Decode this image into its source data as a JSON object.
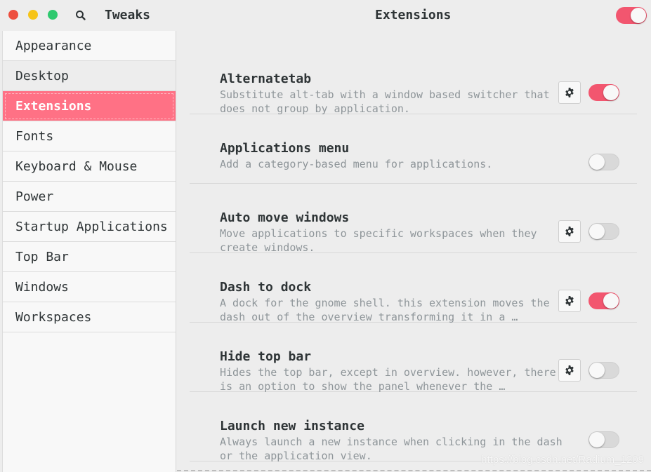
{
  "window": {
    "app_title": "Tweaks",
    "page_title": "Extensions",
    "global_extensions_enabled": true,
    "controls": [
      "close",
      "minimize",
      "maximize"
    ]
  },
  "sidebar": {
    "items": [
      {
        "label": "Appearance",
        "state": "normal"
      },
      {
        "label": "Desktop",
        "state": "hover"
      },
      {
        "label": "Extensions",
        "state": "active"
      },
      {
        "label": "Fonts",
        "state": "normal"
      },
      {
        "label": "Keyboard & Mouse",
        "state": "normal"
      },
      {
        "label": "Power",
        "state": "normal"
      },
      {
        "label": "Startup Applications",
        "state": "normal"
      },
      {
        "label": "Top Bar",
        "state": "normal"
      },
      {
        "label": "Windows",
        "state": "normal"
      },
      {
        "label": "Workspaces",
        "state": "normal"
      }
    ]
  },
  "extensions": [
    {
      "name": "Alternatetab",
      "description": "Substitute alt-tab with a window based switcher that does not group by application.",
      "has_settings": true,
      "enabled": true
    },
    {
      "name": "Applications menu",
      "description": "Add a category-based menu for applications.",
      "has_settings": false,
      "enabled": false
    },
    {
      "name": "Auto move windows",
      "description": "Move applications to specific workspaces when they create windows.",
      "has_settings": true,
      "enabled": false
    },
    {
      "name": "Dash to dock",
      "description": "A dock for the gnome shell. this extension moves the dash out of the overview transforming it in a …",
      "has_settings": true,
      "enabled": true
    },
    {
      "name": "Hide top bar",
      "description": "Hides the top bar, except in overview. however, there is an option to show the panel whenever the …",
      "has_settings": true,
      "enabled": false
    },
    {
      "name": "Launch new instance",
      "description": "Always launch a new instance when clicking in the dash or the application view.",
      "has_settings": false,
      "enabled": false
    }
  ],
  "colors": {
    "accent": "#ff7185",
    "switch_on": "#f2566f",
    "switch_off": "#d9d9d9",
    "close": "#ed4f3f",
    "minimize": "#f6c418",
    "maximize": "#2fc96f"
  },
  "watermark": "https://blog.csdn.net/Radium_1209"
}
